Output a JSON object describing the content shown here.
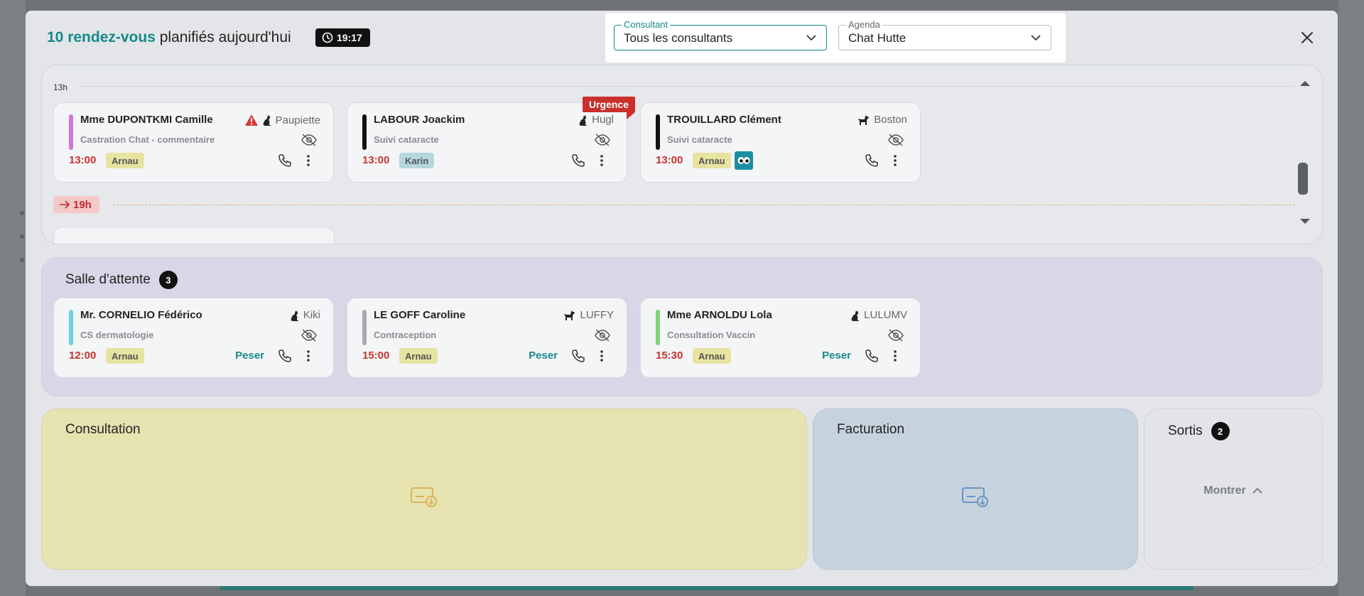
{
  "header": {
    "count_text": "10 rendez-vous",
    "rest_text": " planifiés aujourd'hui",
    "time": "19:17"
  },
  "filters": {
    "consultant_label": "Consultant",
    "consultant_value": "Tous les consultants",
    "agenda_label": "Agenda",
    "agenda_value": "Chat Hutte"
  },
  "schedule": {
    "hour_label": "13h",
    "now_label": "19h",
    "cards": [
      {
        "name": "Mme DUPONTKMI Camille",
        "pet": "Paupiette",
        "reason": "Castration Chat - commentaire",
        "time": "13:00",
        "vet": "Arnau"
      },
      {
        "name": "LABOUR Joackim",
        "pet": "Hugl",
        "reason": "Suivi cataracte",
        "time": "13:00",
        "vet": "Karin",
        "urgent": "Urgence"
      },
      {
        "name": "TROUILLARD Clément",
        "pet": "Boston",
        "reason": "Suivi cataracte",
        "time": "13:00",
        "vet": "Arnau"
      }
    ]
  },
  "waiting": {
    "title": "Salle d'attente",
    "count": "3",
    "weigh_label": "Peser",
    "cards": [
      {
        "name": "Mr. CORNELIO Fédérico",
        "pet": "Kiki",
        "reason": "CS dermatologie",
        "time": "12:00",
        "vet": "Arnau"
      },
      {
        "name": "LE GOFF Caroline",
        "pet": "LUFFY",
        "reason": "Contraception",
        "time": "15:00",
        "vet": "Arnau"
      },
      {
        "name": "Mme ARNOLDU Lola",
        "pet": "LULUMV",
        "reason": "Consultation Vaccin",
        "time": "15:30",
        "vet": "Arnau"
      }
    ]
  },
  "consultation": {
    "title": "Consultation"
  },
  "billing": {
    "title": "Facturation"
  },
  "out": {
    "title": "Sortis",
    "count": "2",
    "show_label": "Montrer"
  },
  "colors": {
    "accent": "#138b8a",
    "urgent": "#c9302c",
    "time_red": "#c8332f",
    "bar_pink": "#d277d8",
    "bar_black": "#111111",
    "bar_cyan": "#6fd1da",
    "bar_gray": "#a9aaad",
    "bar_green": "#7bd47a"
  }
}
